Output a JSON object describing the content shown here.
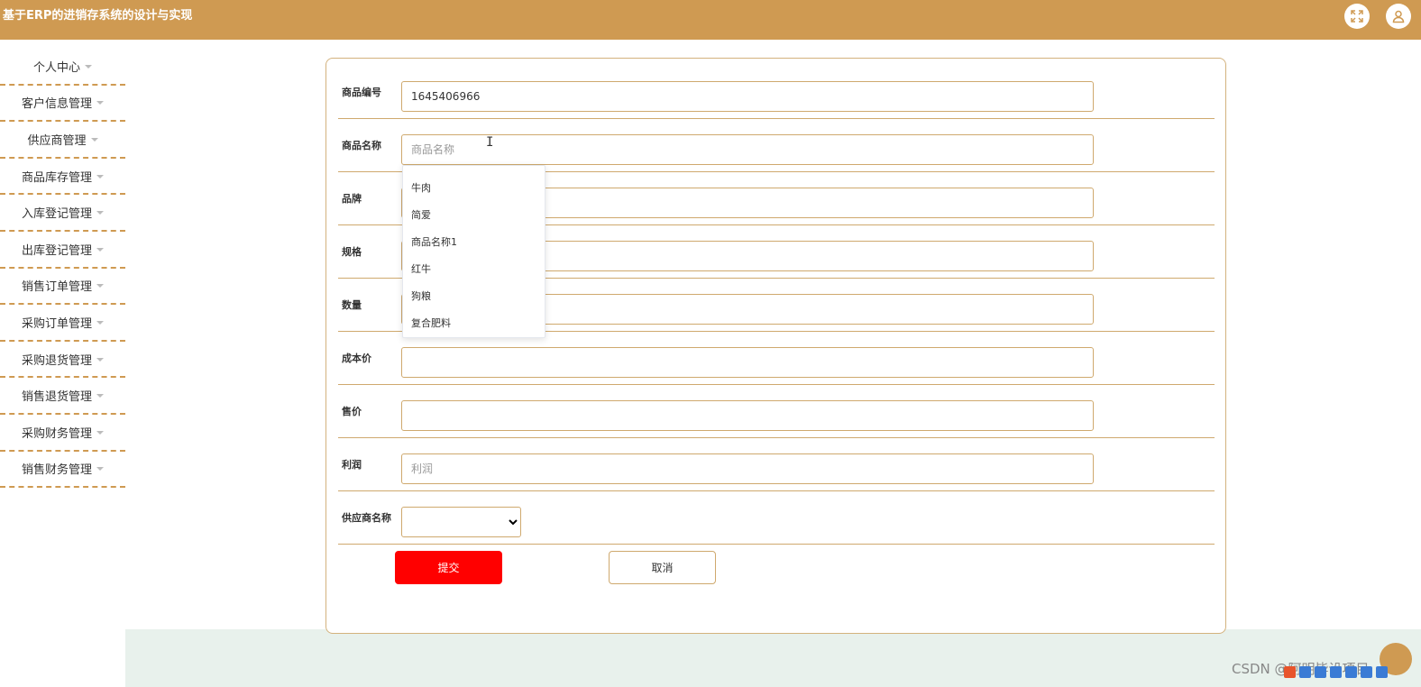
{
  "header": {
    "title": "基于ERP的进销存系统的设计与实现",
    "icons": [
      "fullscreen-icon",
      "user-icon"
    ]
  },
  "sidebar": {
    "items": [
      {
        "label": "个人中心"
      },
      {
        "label": "客户信息管理"
      },
      {
        "label": "供应商管理"
      },
      {
        "label": "商品库存管理"
      },
      {
        "label": "入库登记管理"
      },
      {
        "label": "出库登记管理"
      },
      {
        "label": "销售订单管理"
      },
      {
        "label": "采购订单管理"
      },
      {
        "label": "采购退货管理"
      },
      {
        "label": "销售退货管理"
      },
      {
        "label": "采购财务管理"
      },
      {
        "label": "销售财务管理"
      }
    ]
  },
  "form": {
    "fields": [
      {
        "label": "商品编号",
        "value": "1645406966",
        "placeholder": ""
      },
      {
        "label": "商品名称",
        "value": "",
        "placeholder": "商品名称"
      },
      {
        "label": "品牌",
        "value": "",
        "placeholder": ""
      },
      {
        "label": "规格",
        "value": "",
        "placeholder": ""
      },
      {
        "label": "数量",
        "value": "",
        "placeholder": ""
      },
      {
        "label": "成本价",
        "value": "",
        "placeholder": ""
      },
      {
        "label": "售价",
        "value": "",
        "placeholder": ""
      },
      {
        "label": "利润",
        "value": "",
        "placeholder": "利润"
      }
    ],
    "supplier": {
      "label": "供应商名称",
      "selected": ""
    },
    "name_suggestions": [
      "牛肉",
      "简爱",
      "商品名称1",
      "红牛",
      "狗粮",
      "复合肥料"
    ],
    "submit_label": "提交",
    "cancel_label": "取消"
  },
  "footer": {
    "watermark": "CSDN @阿明毕设项目"
  },
  "colors": {
    "header_bg": "#cf9a52",
    "accent_border": "#cfa96e",
    "submit_bg": "#ff0000",
    "footer_bg": "#e8f1ec"
  }
}
